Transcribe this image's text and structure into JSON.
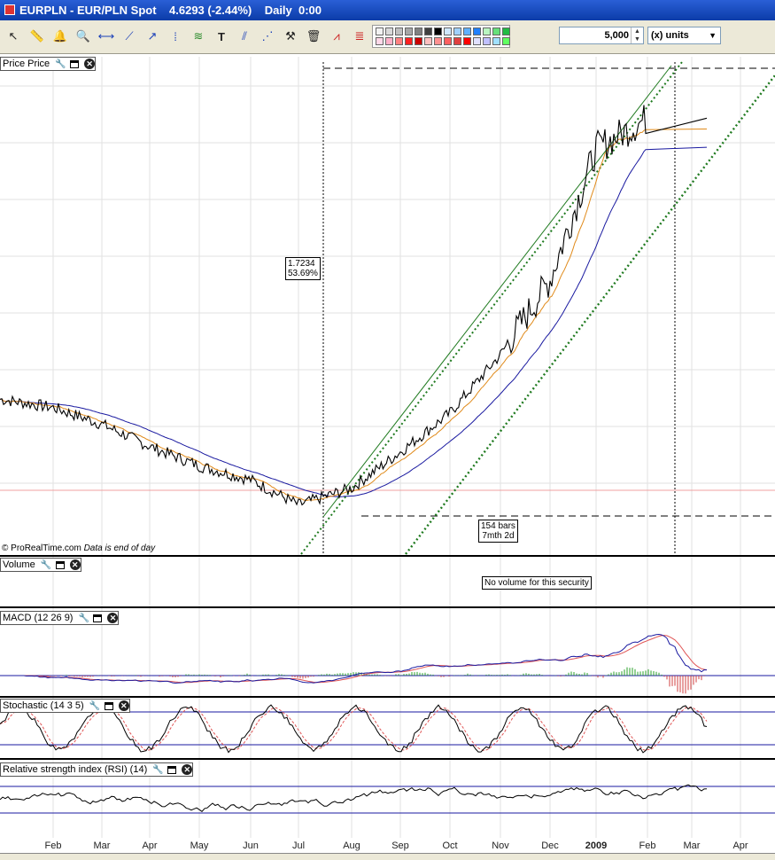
{
  "window": {
    "title_symbol": "EURPLN - EUR/PLN Spot",
    "title_quote": "4.6293 (-2.44%)",
    "title_period": "Daily  0:00"
  },
  "toolbar": {
    "tools": [
      "select-icon",
      "ruler-icon",
      "alert-bell-icon",
      "zoom-icon",
      "horizontal-line-icon",
      "trend-line-icon",
      "ray-line-icon",
      "vertical-line-icon",
      "regression-icon",
      "text-icon",
      "parallel-icon",
      "channel-icon",
      "hammer-icon",
      "trash-icon",
      "indicator-icon",
      "fibonacci-icon"
    ],
    "quantity": "5,000",
    "units": "(x) units",
    "palette": [
      "#f2f2f2",
      "#d9d9d9",
      "#bfbfbf",
      "#a6a6a6",
      "#808080",
      "#404040",
      "#000000",
      "#cfe8ff",
      "#9fd0ff",
      "#5fb0ff",
      "#2080ff",
      "#b9f5c0",
      "#66e07a",
      "#22bb44",
      "#ffd8e8",
      "#ffb0c8",
      "#ff8080",
      "#ff2020",
      "#cc0000",
      "#ffc0c0",
      "#ff9090",
      "#ff6060",
      "#e04040",
      "#ff0000",
      "#e0e0ff",
      "#c0c0ff",
      "#a0e0ff",
      "#60ff60"
    ]
  },
  "panels": {
    "price": {
      "label": "Price Price",
      "copyright": "© ProRealTime.com",
      "data_note": "Data is end of day",
      "fib_value": "1.7234",
      "fib_pct": "53.69%",
      "range_bars": "154 bars",
      "range_time": "7mth 2d"
    },
    "volume": {
      "label": "Volume",
      "message": "No volume for this security"
    },
    "macd": {
      "label": "MACD (12 26 9)"
    },
    "stochastic": {
      "label": "Stochastic (14 3 5)"
    },
    "rsi": {
      "label": "Relative strength index (RSI) (14)"
    }
  },
  "x_axis": {
    "months": [
      "Feb",
      "Mar",
      "Apr",
      "May",
      "Jun",
      "Jul",
      "Aug",
      "Sep",
      "Oct",
      "Nov",
      "Dec",
      "2009",
      "Feb",
      "Mar",
      "Apr"
    ]
  },
  "chart_data": {
    "type": "line",
    "title": "EURPLN - EUR/PLN Spot",
    "last_price": 4.6293,
    "change_pct": -2.44,
    "period": "Daily",
    "x": [
      "Feb",
      "Mar",
      "Apr",
      "May",
      "Jun",
      "Jul",
      "Aug",
      "Sep",
      "Oct",
      "Nov",
      "Dec",
      "2009",
      "Feb",
      "Mar",
      "Apr"
    ],
    "series": [
      {
        "values": [
          3.62,
          3.59,
          3.53,
          3.45,
          3.38,
          3.33,
          3.24,
          3.3,
          3.43,
          3.57,
          3.78,
          4.05,
          4.52,
          4.63
        ]
      }
    ],
    "annotations": [
      "1.7234",
      "53.69%",
      "154 bars",
      "7mth 2d",
      "No volume for this security"
    ],
    "grid": true
  }
}
